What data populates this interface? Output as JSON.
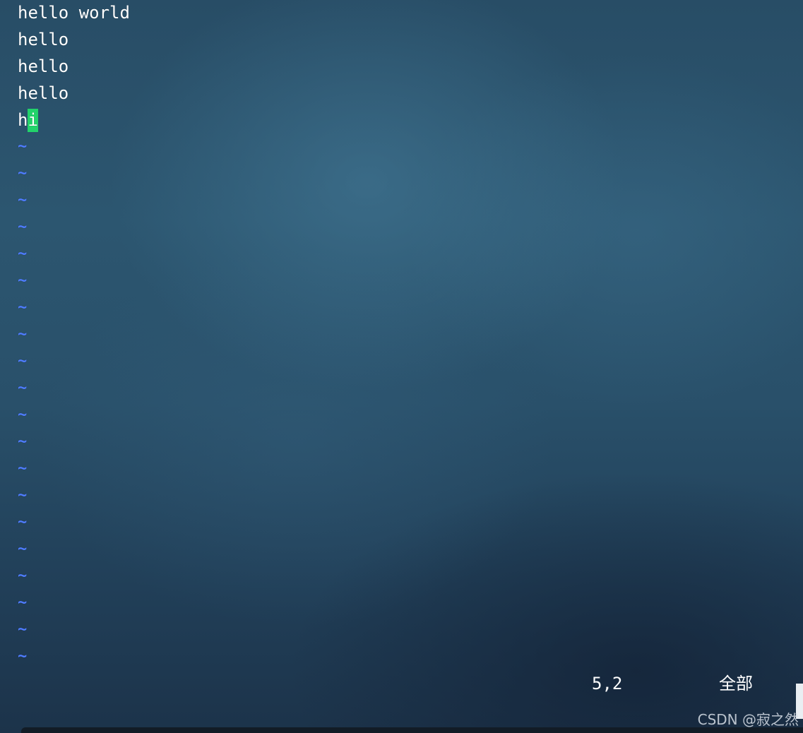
{
  "editor": {
    "lines": [
      "hello world",
      "hello",
      "hello",
      "hello"
    ],
    "cursor_line": {
      "before": "h",
      "cursor": "i",
      "after": ""
    },
    "tilde": "~",
    "tilde_count": 20
  },
  "status": {
    "position": "5,2",
    "range": "全部"
  },
  "watermark": "CSDN @寂之然",
  "colors": {
    "text": "#ffffff",
    "tilde": "#4f7dff",
    "cursor": "#22d36a"
  }
}
